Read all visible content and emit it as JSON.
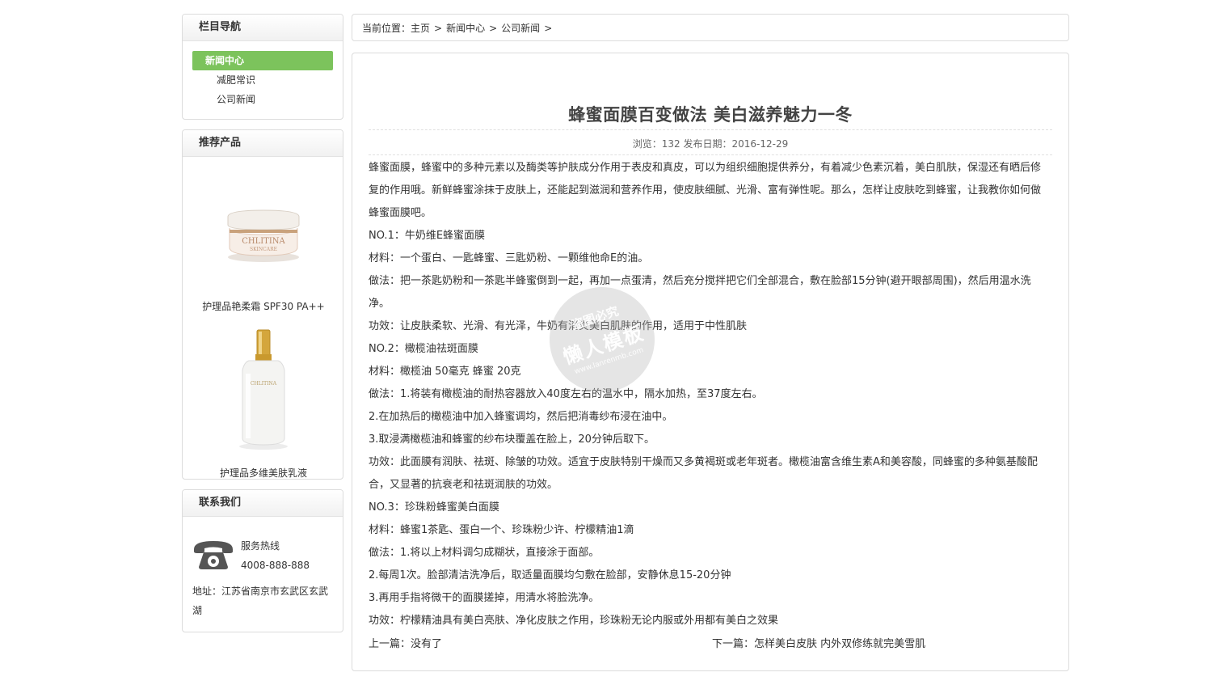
{
  "sidebar": {
    "nav": {
      "title": "栏目导航",
      "active": "新闻中心",
      "items": [
        "减肥常识",
        "公司新闻"
      ]
    },
    "products": {
      "title": "推荐产品",
      "items": [
        {
          "caption": "护理品艳柔霜 SPF30 PA++",
          "brand": "CHLITINA",
          "sub": "SKINCARE"
        },
        {
          "caption": "护理品多维美肤乳液",
          "brand": "CHLITINA"
        }
      ]
    },
    "contact": {
      "title": "联系我们",
      "hotline_label": "服务热线",
      "hotline_number": "4008-888-888",
      "address": "地址：江苏省南京市玄武区玄武湖"
    }
  },
  "breadcrumb": {
    "prefix": "当前位置：",
    "items": [
      "主页",
      "新闻中心",
      "公司新闻"
    ],
    "separator": ">"
  },
  "article": {
    "title": "蜂蜜面膜百变做法 美白滋养魅力一冬",
    "meta": "浏览：132 发布日期：2016-12-29",
    "paragraphs": [
      "蜂蜜面膜，蜂蜜中的多种元素以及酶类等护肤成分作用于表皮和真皮，可以为组织细胞提供养分，有着减少色素沉着，美白肌肤，保湿还有晒后修复的作用哦。新鲜蜂蜜涂抹于皮肤上，还能起到滋润和营养作用，使皮肤细腻、光滑、富有弹性呢。那么，怎样让皮肤吃到蜂蜜，让我教你如何做蜂蜜面膜吧。",
      "NO.1：牛奶维E蜂蜜面膜",
      "材料：一个蛋白、一匙蜂蜜、三匙奶粉、一颗维他命E的油。",
      "做法：把一茶匙奶粉和一茶匙半蜂蜜倒到一起，再加一点蛋清，然后充分搅拌把它们全部混合，敷在脸部15分钟(避开眼部周围)，然后用温水洗净。",
      "功效：让皮肤柔软、光滑、有光泽，牛奶有消炎美白肌肤的作用，适用于中性肌肤",
      "NO.2：橄榄油祛斑面膜",
      "材料：橄榄油 50毫克 蜂蜜 20克",
      "做法：1.将装有橄榄油的耐热容器放入40度左右的温水中，隔水加热，至37度左右。",
      "2.在加热后的橄榄油中加入蜂蜜调均，然后把消毒纱布浸在油中。",
      "3.取浸满橄榄油和蜂蜜的纱布块覆盖在脸上，20分钟后取下。",
      "功效：此面膜有润肤、祛斑、除皱的功效。适宜于皮肤特别干燥而又多黄褐斑或老年斑者。橄榄油富含维生素A和美容酸，同蜂蜜的多种氨基酸配合，又显著的抗衰老和祛斑润肤的功效。",
      "NO.3：珍珠粉蜂蜜美白面膜",
      "材料：蜂蜜1茶匙、蛋白一个、珍珠粉少许、柠檬精油1滴",
      "做法：1.将以上材料调匀成糊状，直接涂于面部。",
      "2.每周1次。脸部清洁洗净后，取适量面膜均匀敷在脸部，安静休息15-20分钟",
      "3.再用手指将微干的面膜搓掉，用清水将脸洗净。",
      "功效：柠檬精油具有美白亮肤、净化皮肤之作用，珍珠粉无论内服或外用都有美白之效果"
    ],
    "prev": "上一篇：没有了",
    "next": "下一篇：怎样美白皮肤 内外双修练就完美雪肌"
  },
  "watermark": {
    "line1": "盗图必究",
    "line2": "懒人模板",
    "line3": "www.lanrenmb.com"
  }
}
